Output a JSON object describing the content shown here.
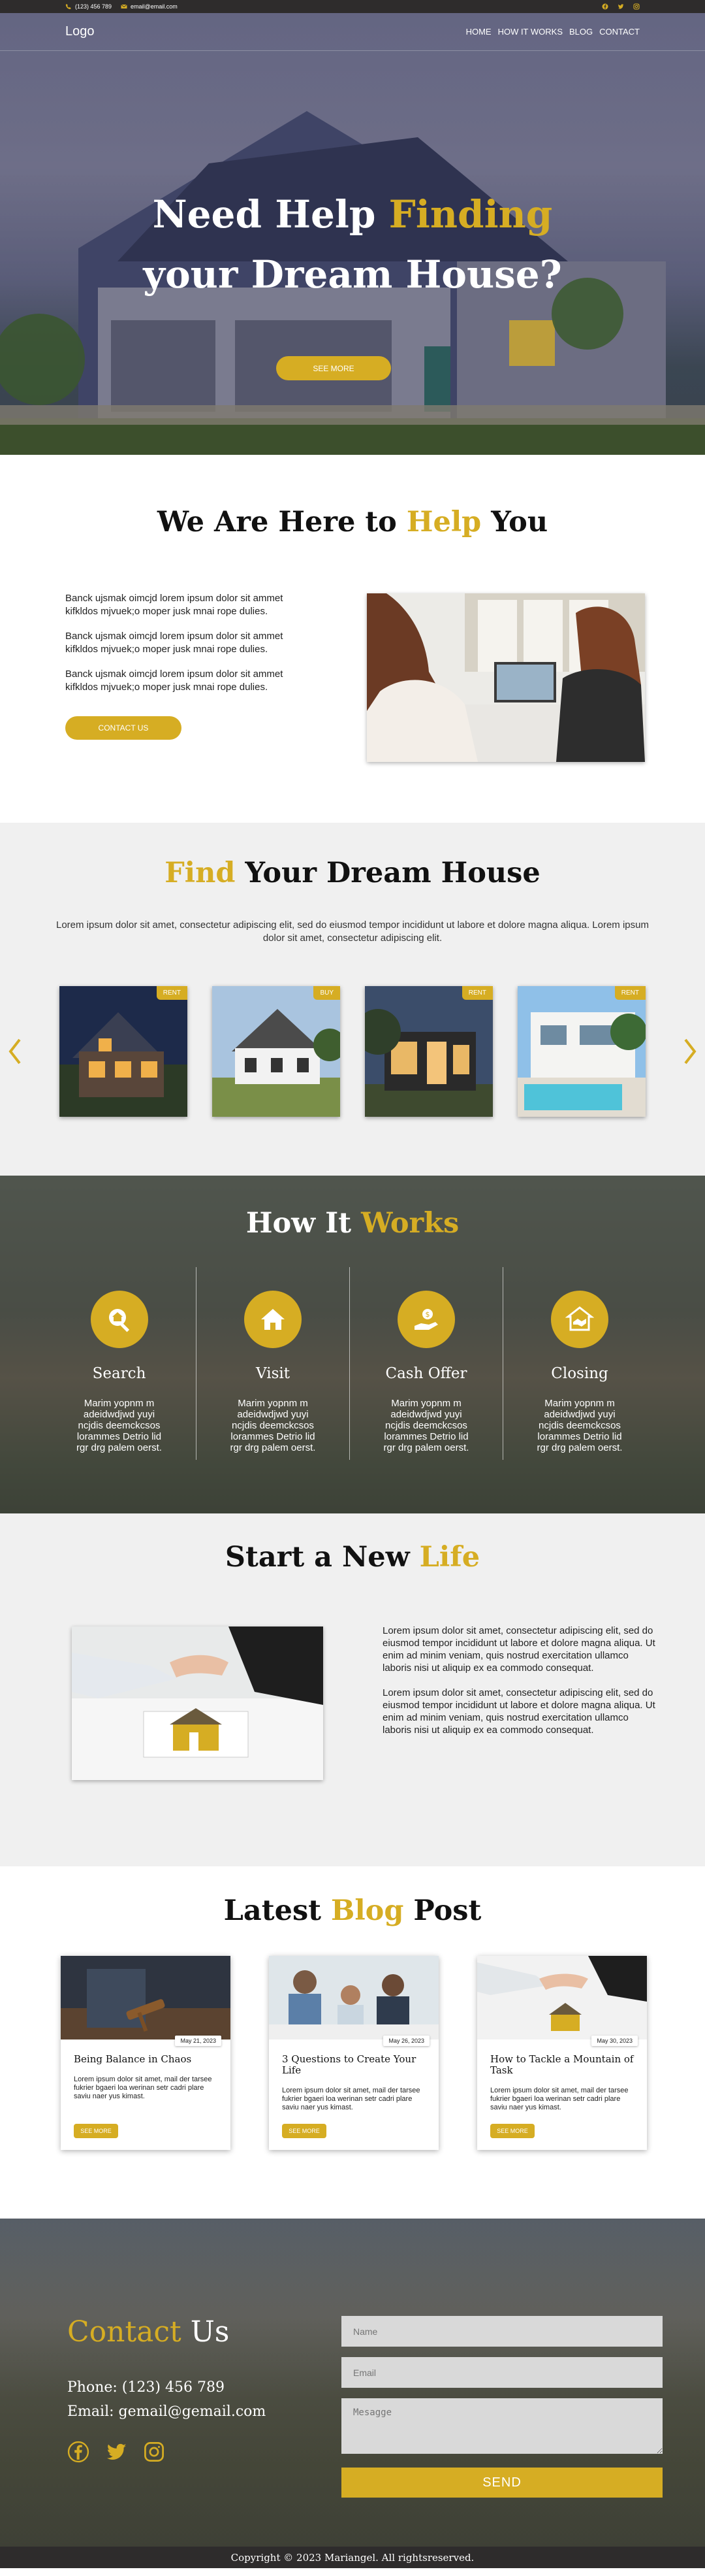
{
  "topbar": {
    "phone": "(123) 456 789",
    "email": "email@email.com"
  },
  "nav": {
    "logo": "Logo",
    "items": [
      "HOME",
      "HOW IT WORKS",
      "BLOG",
      "CONTACT"
    ]
  },
  "hero": {
    "title_part1": "Need Help ",
    "title_highlight": "Finding",
    "title_part2": "your Dream House?",
    "button": "SEE MORE"
  },
  "help": {
    "title_part1": "We Are Here to ",
    "title_highlight": "Help",
    "title_part2": " You",
    "paragraphs": [
      "Banck ujsmak oimcjd lorem ipsum dolor sit ammet kifkldos mjvuek;o moper jusk mnai rope dulies.",
      "Banck ujsmak oimcjd lorem ipsum dolor sit ammet kifkldos mjvuek;o moper jusk mnai rope dulies.",
      "Banck ujsmak oimcjd lorem ipsum dolor sit ammet kifkldos mjvuek;o moper jusk mnai rope dulies."
    ],
    "button": "CONTACT US"
  },
  "find": {
    "title_highlight": "Find",
    "title_rest": " Your Dream House",
    "subtitle": "Lorem ipsum dolor sit amet, consectetur adipiscing elit, sed do eiusmod tempor incididunt ut labore et dolore magna aliqua. Lorem ipsum dolor sit amet, consectetur adipiscing elit.",
    "cards": [
      {
        "badge": "RENT"
      },
      {
        "badge": "BUY"
      },
      {
        "badge": "RENT"
      },
      {
        "badge": "RENT"
      }
    ]
  },
  "how": {
    "title_part1": "How It ",
    "title_highlight": "Works",
    "steps": [
      {
        "title": "Search",
        "icon": "search-house-icon",
        "text": "Marim yopnm m adeidwdjwd yuyi ncjdis deemckcsos lorammes Detrio lid rgr drg palem oerst."
      },
      {
        "title": "Visit",
        "icon": "house-icon",
        "text": "Marim yopnm m adeidwdjwd yuyi ncjdis deemckcsos lorammes Detrio lid rgr drg palem oerst."
      },
      {
        "title": "Cash Offer",
        "icon": "hand-money-icon",
        "text": "Marim yopnm m adeidwdjwd yuyi ncjdis deemckcsos lorammes Detrio lid rgr drg palem oerst."
      },
      {
        "title": "Closing",
        "icon": "handshake-house-icon",
        "text": "Marim yopnm m adeidwdjwd yuyi ncjdis deemckcsos lorammes Detrio lid rgr drg palem oerst."
      }
    ]
  },
  "life": {
    "title_part1": "Start a New ",
    "title_highlight": "Life",
    "paragraphs": [
      "Lorem ipsum dolor sit amet, consectetur adipiscing elit, sed do eiusmod tempor incididunt ut labore et dolore magna aliqua. Ut enim ad minim veniam, quis nostrud exercitation ullamco laboris nisi ut aliquip ex ea commodo consequat.",
      "Lorem ipsum dolor sit amet, consectetur adipiscing elit, sed do eiusmod tempor incididunt ut labore et dolore magna aliqua. Ut enim ad minim veniam, quis nostrud exercitation ullamco laboris nisi ut aliquip ex ea commodo consequat."
    ]
  },
  "blog": {
    "title_part1": "Latest ",
    "title_highlight": "Blog",
    "title_part2": " Post",
    "posts": [
      {
        "date": "May 21, 2023",
        "title": "Being Balance in Chaos",
        "text": "Lorem ipsum dolor sit amet, mail der tarsee fukrier bgaeri loa werinan setr cadri plare saviu naer yus kimast.",
        "button": "SEE MORE"
      },
      {
        "date": "May 26, 2023",
        "title": "3 Questions to Create Your Life",
        "text": "Lorem ipsum dolor sit amet, mail der tarsee fukrier bgaeri loa werinan setr cadri plare saviu naer yus kimast.",
        "button": "SEE MORE"
      },
      {
        "date": "May 30, 2023",
        "title": "How to Tackle a Mountain of Task",
        "text": "Lorem ipsum dolor sit amet, mail der tarsee fukrier bgaeri loa werinan setr cadri plare saviu naer yus kimast.",
        "button": "SEE MORE"
      }
    ]
  },
  "contact": {
    "title_highlight": "Contact",
    "title_rest": " Us",
    "phone": "Phone: (123) 456 789",
    "email": "Email: gemail@gemail.com",
    "form": {
      "name_placeholder": "Name",
      "email_placeholder": "Email",
      "message_placeholder": "Mesagge",
      "send": "SEND"
    }
  },
  "footer": {
    "text": "Copyright © 2023 Mariangel. All rightsreserved."
  },
  "colors": {
    "accent": "#d6ad23",
    "dark": "#2e2c2c",
    "light_bg": "#f0f0f0"
  }
}
